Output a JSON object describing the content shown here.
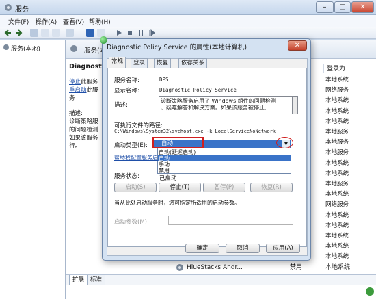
{
  "window": {
    "title": "服务"
  },
  "menu": [
    "文件(F)",
    "操作(A)",
    "查看(V)",
    "帮助(H)"
  ],
  "tree": {
    "root": "服务(本地)"
  },
  "content": {
    "header_title": "服务(本地)",
    "service_heading": "Diagnosti",
    "link_stop": "停止",
    "link_stop_rest": "此服务",
    "link_restart": "重启动",
    "link_restart_rest": "此服务",
    "desc_label": "描述:",
    "desc_lines": [
      "诊断策略服",
      "的问题检测",
      "如果该服务",
      "行。"
    ],
    "column_login": "登录为",
    "login_rows": [
      "本地系统",
      "网络服务",
      "本地系统",
      "本地系统",
      "本地系统",
      "本地服务",
      "本地服务",
      "本地服务",
      "本地系统",
      "本地系统",
      "本地服务",
      "本地系统",
      "网络服务",
      "本地系统",
      "本地系统",
      "本地系统",
      "本地系统",
      "本地系统"
    ],
    "bottom_row": {
      "name": "HlueStacks Andr...",
      "startup": "禁用",
      "login": "本地系统"
    },
    "bottom_tabs": [
      "扩展",
      "标准"
    ]
  },
  "dialog": {
    "title": "Diagnostic Policy Service 的属性(本地计算机)",
    "tabs": [
      "常规",
      "登录",
      "恢复",
      "依存关系"
    ],
    "service_name_label": "服务名称:",
    "service_name": "DPS",
    "display_name_label": "显示名称:",
    "display_name": "Diagnostic Policy Service",
    "description_label": "描述:",
    "description_line1": "诊断策略服务启用了 Windows 组件的问题检测",
    "description_line2": "、疑难解答和解决方案。如果该服务被停止,",
    "path_label": "可执行文件的路径:",
    "path": "C:\\Windows\\System32\\svchost.exe -k LocalServiceNoNetwork",
    "startup_type_label": "启动类型(E):",
    "startup_type_value": "自动",
    "dropdown_options": [
      "自动(延迟启动)",
      "自动",
      "手动",
      "禁用"
    ],
    "help_link": "帮助我配置服务启",
    "status_label": "服务状态:",
    "status_value": "已启动",
    "btn_start": "启动(S)",
    "btn_stop": "停止(T)",
    "btn_pause": "暂停(P)",
    "btn_resume": "恢复(R)",
    "hint": "当从此处启动服务时，您可指定所适用的启动参数。",
    "params_label": "启动参数(M):",
    "ok": "确定",
    "cancel": "取消",
    "apply": "应用(A)"
  },
  "colors": {
    "accent": "#3a73c8",
    "highlight_red": "#d01f1f",
    "link": "#1f4fa8"
  }
}
